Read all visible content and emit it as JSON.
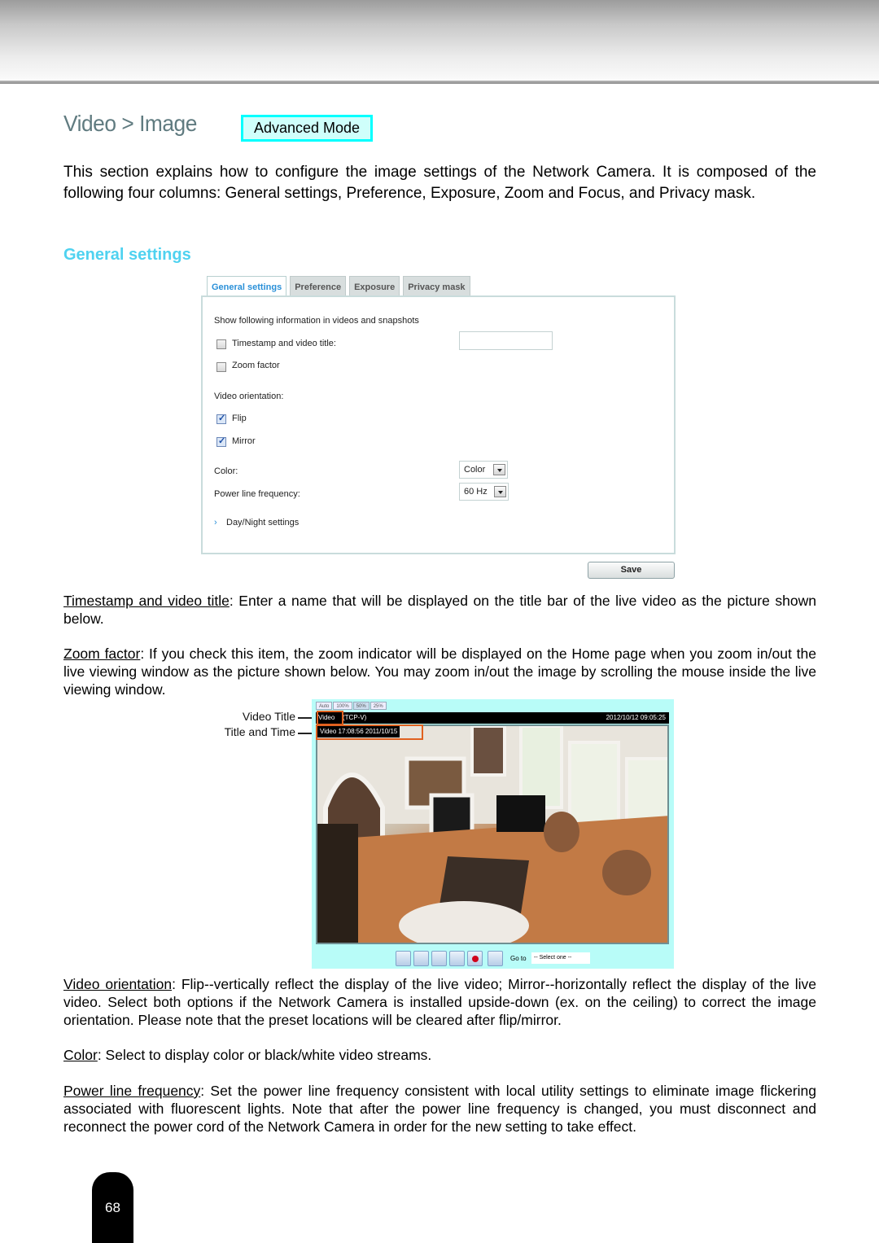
{
  "header": {
    "title": "Video > Image",
    "mode_badge": "Advanced Mode"
  },
  "intro": "This section explains how to configure the image settings of the Network Camera. It is composed of the following four columns: General settings, Preference, Exposure, Zoom and Focus, and Privacy mask.",
  "section_heading": "General settings",
  "settings_panel": {
    "tabs": [
      {
        "label": "General settings",
        "active": true
      },
      {
        "label": "Preference",
        "active": false
      },
      {
        "label": "Exposure",
        "active": false
      },
      {
        "label": "Privacy mask",
        "active": false
      }
    ],
    "show_info_label": "Show following information in videos and snapshots",
    "timestamp_label": "Timestamp and video title:",
    "timestamp_checked": false,
    "timestamp_value": "",
    "zoom_factor_label": "Zoom factor",
    "zoom_factor_checked": false,
    "orientation_label": "Video orientation:",
    "flip_label": "Flip",
    "flip_checked": true,
    "mirror_label": "Mirror",
    "mirror_checked": true,
    "color_label": "Color:",
    "color_value": "Color",
    "power_label": "Power line frequency:",
    "power_value": "60 Hz",
    "daynight_label": "Day/Night settings",
    "save_label": "Save"
  },
  "descriptions": {
    "timestamp": {
      "term": "Timestamp and video title",
      "text": ": Enter a name that will be displayed on the title bar of the live video as the picture shown below."
    },
    "zoom": {
      "term": "Zoom factor",
      "text": ": If you check this item, the zoom indicator will be displayed on the Home page when you zoom in/out the live viewing window as the picture shown below. You may zoom in/out the image by scrolling the mouse inside the live viewing window."
    },
    "orientation": {
      "term": "Video orientation",
      "text": ": Flip--vertically reflect the display of the live video; Mirror--horizontally reflect the display of the live video. Select both options if the Network Camera is installed upside-down (ex. on the ceiling) to correct the image orientation. Please note that the preset locations will be cleared after flip/mirror."
    },
    "color": {
      "term": "Color",
      "text": ": Select to display color or black/white video streams."
    },
    "power": {
      "term": "Power line frequency",
      "text": ": Set the power line frequency consistent with local utility settings to eliminate image flickering associated with fluorescent lights. Note that after the power line frequency is changed, you must disconnect and reconnect the power cord of the Network Camera in order for the new setting to take effect."
    }
  },
  "live_view": {
    "callout_video_title": "Video Title",
    "callout_title_time": "Title and Time",
    "zoom_buttons": [
      "Auto",
      "100%",
      "50%",
      "25%"
    ],
    "title_text": "Video",
    "protocol_text": "(TCP-V)",
    "timestamp_text": "2012/10/12  09:05:25",
    "overlay_text": "Video 17:08:56  2011/10/15",
    "controls": [
      "snapshot-icon",
      "digital-zoom-icon",
      "pause-icon",
      "stop-icon",
      "record-icon",
      "fullscreen-icon"
    ],
    "goto_label": "Go to",
    "goto_value": "-- Select one --"
  },
  "footer": {
    "page_number": "68"
  }
}
